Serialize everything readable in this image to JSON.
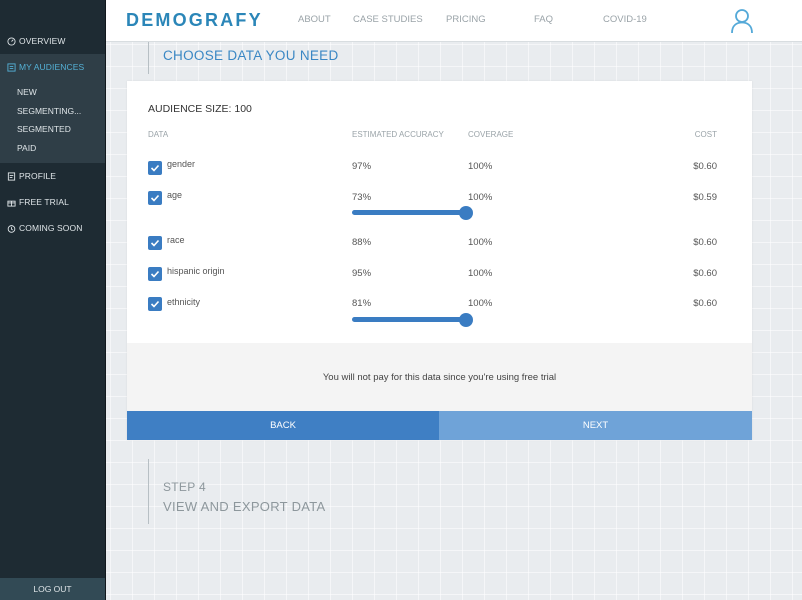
{
  "brand": {
    "logo": "DEMOGRAFY",
    "accent": "#2b86b8",
    "primary_button": "#3f7fc4",
    "secondary_button": "#6fa3d8"
  },
  "nav": {
    "links": [
      "ABOUT",
      "CASE STUDIES",
      "PRICING",
      "FAQ",
      "COVID-19"
    ],
    "user_icon": "user-icon"
  },
  "sidebar": {
    "overview": "OVERVIEW",
    "my_audiences": "MY AUDIENCES",
    "sub_items": [
      "NEW",
      "SEGMENTING...",
      "SEGMENTED",
      "PAID"
    ],
    "profile": "PROFILE",
    "free_trial": "FREE TRIAL",
    "coming_soon": "COMING SOON",
    "logout": "LOG OUT"
  },
  "step3": {
    "title": "CHOOSE DATA YOU NEED"
  },
  "audience": {
    "size_label": "AUDIENCE SIZE: 100",
    "columns": {
      "data": "DATA",
      "accuracy": "ESTIMATED ACCURACY",
      "coverage": "COVERAGE",
      "cost": "COST"
    },
    "rows": [
      {
        "label": "gender",
        "accuracy": "97%",
        "coverage": "100%",
        "cost": "$0.60",
        "checked": true
      },
      {
        "label": "age",
        "accuracy": "73%",
        "coverage": "100%",
        "cost": "$0.59",
        "checked": true
      },
      {
        "label": "race",
        "accuracy": "88%",
        "coverage": "100%",
        "cost": "$0.60",
        "checked": true
      },
      {
        "label": "hispanic origin",
        "accuracy": "95%",
        "coverage": "100%",
        "cost": "$0.60",
        "checked": true
      },
      {
        "label": "ethnicity",
        "accuracy": "81%",
        "coverage": "100%",
        "cost": "$0.60",
        "checked": true
      }
    ],
    "sliders": {
      "age": 1.0,
      "ethnicity": 1.0
    },
    "notice": "You will not pay for this data since you're using free trial",
    "back": "BACK",
    "next": "NEXT"
  },
  "step4": {
    "number": "STEP 4",
    "title": "VIEW AND EXPORT DATA"
  }
}
